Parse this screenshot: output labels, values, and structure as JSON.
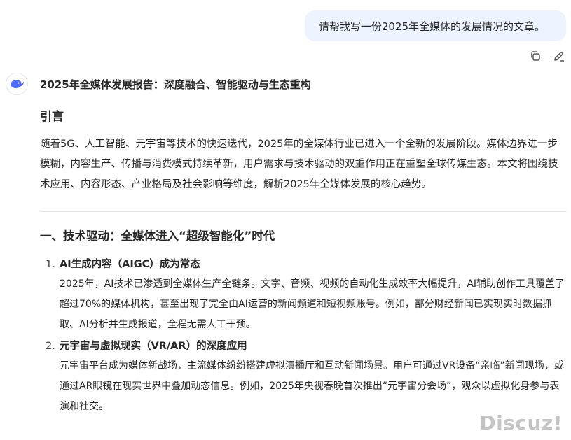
{
  "user_message": "请帮我写一份2025年全媒体的发展情况的文章。",
  "message_actions": [
    {
      "name": "copy",
      "icon": "copy-icon"
    },
    {
      "name": "edit",
      "icon": "edit-icon"
    }
  ],
  "assistant": {
    "avatar_icon": "whale-logo-icon",
    "title": "2025年全媒体发展报告：深度融合、智能驱动与生态重构",
    "intro_heading": "引言",
    "intro_text": "随着5G、人工智能、元宇宙等技术的快速迭代，2025年的全媒体行业已进入一个全新的发展阶段。媒体边界进一步模糊，内容生产、传播与消费模式持续革新，用户需求与技术驱动的双重作用正在重塑全球传媒生态。本文将围绕技术应用、内容形态、产业格局及社会影响等维度，解析2025年全媒体发展的核心趋势。",
    "section1": {
      "heading": "一、技术驱动：全媒体进入“超级智能化”时代",
      "items": [
        {
          "number": "1.",
          "title": "AI生成内容（AIGC）成为常态",
          "body": "2025年，AI技术已渗透到全媒体生产全链条。文字、音频、视频的自动化生成效率大幅提升，AI辅助创作工具覆盖了超过70%的媒体机构，甚至出现了完全由AI运营的新闻频道和短视频账号。例如，部分财经新闻已实现实时数据抓取、AI分析并生成报道，全程无需人工干预。"
        },
        {
          "number": "2.",
          "title": "元宇宙与虚拟现实（VR/AR）的深度应用",
          "body": "元宇宙平台成为媒体新战场，主流媒体纷纷搭建虚拟演播厅和互动新闻场景。用户可通过VR设备“亲临”新闻现场，或通过AR眼镜在现实世界中叠加动态信息。例如，2025年央视春晚首次推出“元宇宙分会场”，观众以虚拟化身参与表演和社交。"
        }
      ]
    }
  },
  "watermark": "Discuz!",
  "colors": {
    "bubble_bg": "#eef4ff",
    "text": "#262626",
    "brand_blue": "#4d6bfe"
  }
}
